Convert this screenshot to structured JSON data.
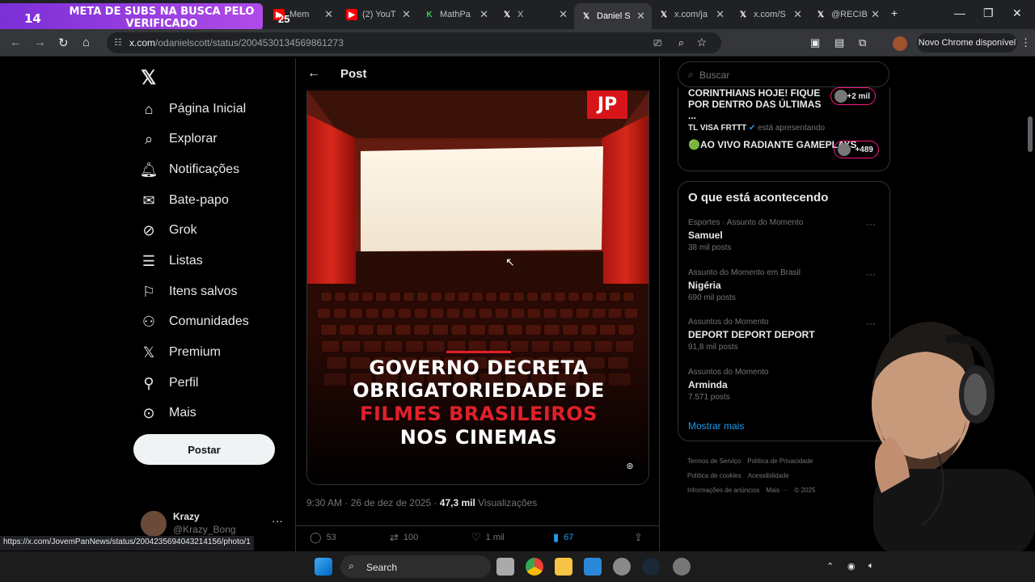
{
  "overlay": {
    "counter": "14",
    "banner_text": "META DE SUBS NA BUSCA PELO VERIFICADO",
    "counter2": "25"
  },
  "browser": {
    "tabs": [
      {
        "label": "Mem",
        "icon": "youtube-icon"
      },
      {
        "label": "(2) YouT",
        "icon": "youtube-icon"
      },
      {
        "label": "MathPa",
        "icon": "mathpapa-icon"
      },
      {
        "label": "X",
        "icon": "x-icon"
      },
      {
        "label": "Daniel S",
        "icon": "x-icon",
        "active": true
      },
      {
        "label": "x.com/ja",
        "icon": "x-icon"
      },
      {
        "label": "x.com/S",
        "icon": "x-icon"
      },
      {
        "label": "@RECIB",
        "icon": "x-icon"
      }
    ],
    "url_host": "x.com",
    "url_path": "/odanielscott/status/2004530134569861273",
    "update_button": "Novo Chrome disponível",
    "status_url": "https://x.com/JovemPanNews/status/2004235694043214156/photo/1"
  },
  "nav": {
    "items": [
      {
        "label": "Página Inicial",
        "icon": "home-icon"
      },
      {
        "label": "Explorar",
        "icon": "search-icon"
      },
      {
        "label": "Notificações",
        "icon": "bell-icon"
      },
      {
        "label": "Bate-papo",
        "icon": "mail-icon"
      },
      {
        "label": "Grok",
        "icon": "grok-icon"
      },
      {
        "label": "Listas",
        "icon": "list-icon"
      },
      {
        "label": "Itens salvos",
        "icon": "bookmark-icon"
      },
      {
        "label": "Comunidades",
        "icon": "communities-icon"
      },
      {
        "label": "Premium",
        "icon": "x-icon"
      },
      {
        "label": "Perfil",
        "icon": "profile-icon"
      },
      {
        "label": "Mais",
        "icon": "more-circle-icon"
      }
    ],
    "post_button": "Postar",
    "profile": {
      "name": "Krazy",
      "handle": "@Krazy_Bong"
    }
  },
  "post": {
    "header": "Post",
    "media_logo": "JP",
    "headline": {
      "l1": "GOVERNO DECRETA",
      "l2": "OBRIGATORIEDADE DE",
      "l3": "FILMES BRASILEIROS",
      "l4": "NOS CINEMAS"
    },
    "time": "9:30 AM · 26 de dez de 2025 · ",
    "views_count": "47,3 mil",
    "views_label": " Visualizações",
    "replies": "53",
    "reposts": "100",
    "likes": "1 mil",
    "bookmarks": "67"
  },
  "right": {
    "search_placeholder": "Buscar",
    "live": {
      "title1": "CORINTHIANS HOJE! FIQUE POR DENTRO DAS ÚLTIMAS ...",
      "count1": "+2 mil",
      "host": "TL VISA FRTTT",
      "host_suffix": " está apresentando",
      "title2": "🟢AO VIVO RADIANTE GAMEPLAYS",
      "count2": "+489"
    },
    "trends_title": "O que está acontecendo",
    "trends": [
      {
        "category": "Esportes · Assunto do Momento",
        "name": "Samuel",
        "count": "38 mil posts"
      },
      {
        "category": "Assunto do Momento em Brasil",
        "name": "Nigéria",
        "count": "690 mil posts"
      },
      {
        "category": "Assuntos do Momento",
        "name": "DEPORT DEPORT DEPORT",
        "count": "91,8 mil posts"
      },
      {
        "category": "Assuntos do Momento",
        "name": "Arminda",
        "count": "7.571 posts"
      }
    ],
    "show_more": "Mostrar mais",
    "footer": [
      "Termos de Serviço",
      "Política de Privacidade",
      "Política de cookies",
      "Acessibilidade",
      "Informações de anúncios",
      "Mais ···",
      "© 2025"
    ]
  },
  "taskbar": {
    "search": "Search"
  }
}
